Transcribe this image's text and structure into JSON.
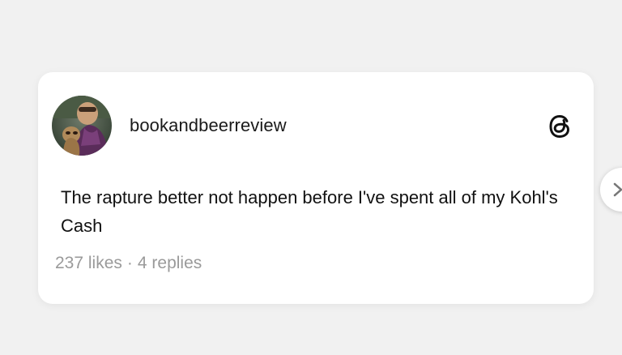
{
  "post": {
    "username": "bookandbeerreview",
    "text": "The rapture better not happen before I've spent all of my Kohl's Cash",
    "likes": "237 likes",
    "separator": "·",
    "replies": "4 replies"
  },
  "icons": {
    "brand": "threads-logo-icon",
    "next": "chevron-right-icon"
  },
  "colors": {
    "background": "#f1f1f1",
    "card": "#ffffff",
    "text": "#111111",
    "meta": "#9a9a9a"
  }
}
